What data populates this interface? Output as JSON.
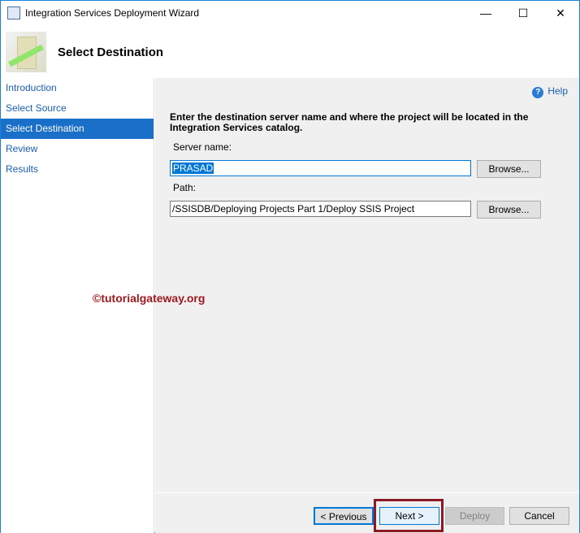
{
  "window": {
    "title": "Integration Services Deployment Wizard",
    "minimize": "—",
    "maximize": "☐",
    "close": "✕"
  },
  "header": {
    "title": "Select Destination"
  },
  "sidebar": {
    "items": [
      {
        "label": "Introduction"
      },
      {
        "label": "Select Source"
      },
      {
        "label": "Select Destination"
      },
      {
        "label": "Review"
      },
      {
        "label": "Results"
      }
    ]
  },
  "main": {
    "help": "Help",
    "instruction": "Enter the destination server name and where the project will be located in the Integration Services catalog.",
    "server_label": "Server name:",
    "server_value": "PRASAD",
    "path_label": "Path:",
    "path_value": "/SSISDB/Deploying Projects Part 1/Deploy SSIS Project",
    "browse1": "Browse...",
    "browse2": "Browse..."
  },
  "watermark": "©tutorialgateway.org",
  "footer": {
    "previous": "< Previous",
    "next": "Next >",
    "deploy": "Deploy",
    "cancel": "Cancel"
  }
}
